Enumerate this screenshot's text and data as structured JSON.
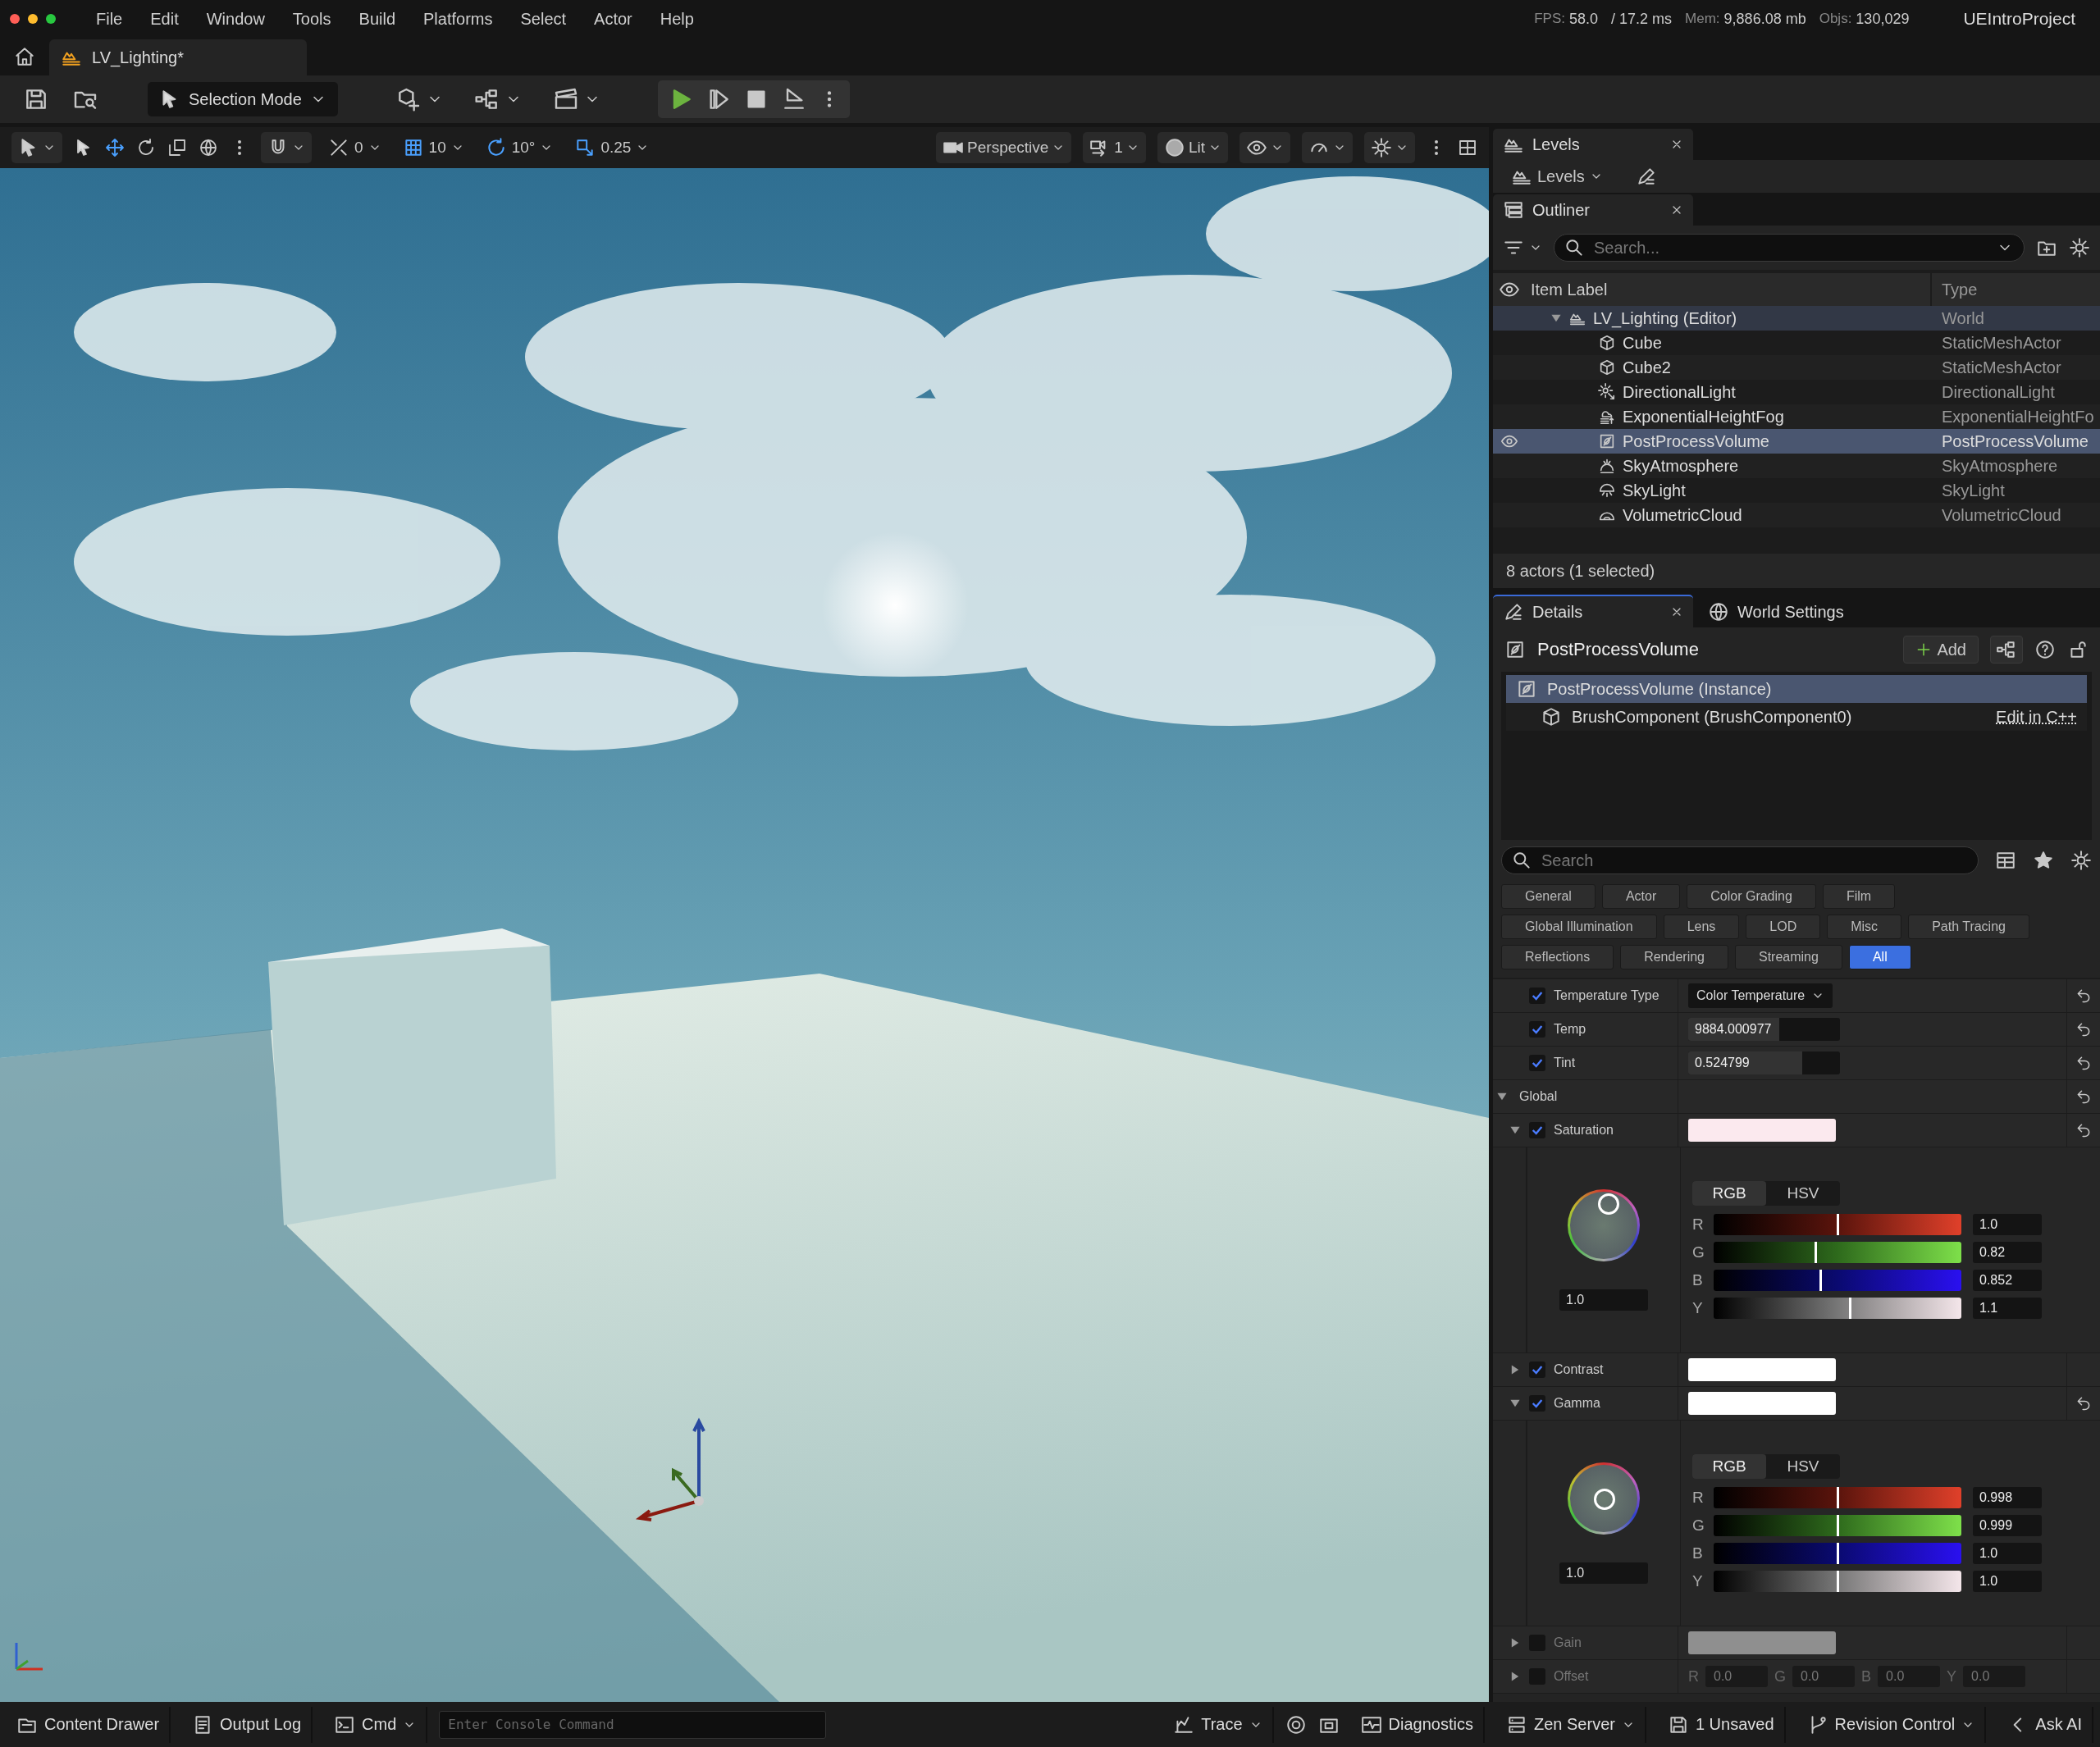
{
  "menu": [
    "File",
    "Edit",
    "Window",
    "Tools",
    "Build",
    "Platforms",
    "Select",
    "Actor",
    "Help"
  ],
  "stats": [
    {
      "label": "FPS:",
      "value": "58.0"
    },
    {
      "value": "/ 17.2 ms"
    },
    {
      "label": "Mem:",
      "value": "9,886.08 mb"
    },
    {
      "label": "Objs:",
      "value": "130,029"
    }
  ],
  "project": "UEIntroProject",
  "document_tab": {
    "label": "LV_Lighting*"
  },
  "toolbar": {
    "mode": "Selection Mode"
  },
  "viewport_toolbar": {
    "snaps": [
      {
        "kind": "surface",
        "value": "0"
      },
      {
        "kind": "grid",
        "value": "10"
      },
      {
        "kind": "rotate",
        "value": "10°"
      },
      {
        "kind": "scale",
        "value": "0.25"
      }
    ],
    "view": "Perspective",
    "camera_speed": "1",
    "view_mode": "Lit"
  },
  "levels": {
    "tab": "Levels",
    "dropdown": "Levels"
  },
  "outliner": {
    "tab": "Outliner",
    "search_placeholder": "Search...",
    "columns": [
      "Item Label",
      "Type"
    ],
    "tree": [
      {
        "label": "LV_Lighting (Editor)",
        "type": "World",
        "kind": "world",
        "expanded": true,
        "selected": false,
        "children": [
          {
            "label": "Cube",
            "type": "StaticMeshActor",
            "kind": "mesh",
            "selected": false
          },
          {
            "label": "Cube2",
            "type": "StaticMeshActor",
            "kind": "mesh",
            "selected": false
          },
          {
            "label": "DirectionalLight",
            "type": "DirectionalLight",
            "kind": "light",
            "selected": false
          },
          {
            "label": "ExponentialHeightFog",
            "type": "ExponentialHeightFo",
            "kind": "fog",
            "selected": false
          },
          {
            "label": "PostProcessVolume",
            "type": "PostProcessVolume",
            "kind": "postprocess",
            "selected": true
          },
          {
            "label": "SkyAtmosphere",
            "type": "SkyAtmosphere",
            "kind": "sky",
            "selected": false
          },
          {
            "label": "SkyLight",
            "type": "SkyLight",
            "kind": "skylight",
            "selected": false
          },
          {
            "label": "VolumetricCloud",
            "type": "VolumetricCloud",
            "kind": "cloud",
            "selected": false
          }
        ]
      }
    ],
    "status": "8 actors (1 selected)"
  },
  "details": {
    "tab": "Details",
    "other_tab": "World Settings",
    "actor": "PostProcessVolume",
    "add": "Add",
    "components": [
      {
        "label": "PostProcessVolume (Instance)",
        "kind": "actor",
        "selected": true
      },
      {
        "label": "BrushComponent (BrushComponent0)",
        "kind": "brush",
        "selected": false,
        "link": "Edit in C++"
      }
    ],
    "search_placeholder": "Search",
    "categories": [
      {
        "label": "General",
        "selected": false
      },
      {
        "label": "Actor",
        "selected": false
      },
      {
        "label": "Color Grading",
        "selected": false
      },
      {
        "label": "Film",
        "selected": false
      },
      {
        "label": "Global Illumination",
        "selected": false
      },
      {
        "label": "Lens",
        "selected": false
      },
      {
        "label": "LOD",
        "selected": false
      },
      {
        "label": "Misc",
        "selected": false
      },
      {
        "label": "Path Tracing",
        "selected": false
      },
      {
        "label": "Reflections",
        "selected": false
      },
      {
        "label": "Rendering",
        "selected": false
      },
      {
        "label": "Streaming",
        "selected": false
      },
      {
        "label": "All",
        "selected": true
      }
    ],
    "properties": [
      {
        "kind": "enum",
        "label": "Temperature Type",
        "checked": true,
        "value": "Color Temperature",
        "resettable": true
      },
      {
        "kind": "number",
        "label": "Temp",
        "checked": true,
        "value": "9884.000977",
        "level": 0.6,
        "resettable": true
      },
      {
        "kind": "number",
        "label": "Tint",
        "checked": true,
        "value": "0.524799",
        "level": 0.75,
        "resettable": true
      },
      {
        "kind": "group",
        "label": "Global",
        "expanded": true,
        "resettable": true
      },
      {
        "kind": "color",
        "label": "Saturation",
        "checked": true,
        "expanded": true,
        "color": "#fbe9ee",
        "resettable": true,
        "picker": {
          "modes": [
            {
              "label": "RGB",
              "selected": true
            },
            {
              "label": "HSV",
              "selected": false
            }
          ],
          "wheel_value": "1.0",
          "channels": [
            {
              "label": "R",
              "value": "1.0",
              "level": 0.5
            },
            {
              "label": "G",
              "value": "0.82",
              "level": 0.41
            },
            {
              "label": "B",
              "value": "0.852",
              "level": 0.43
            },
            {
              "label": "Y",
              "value": "1.1",
              "level": 0.55
            }
          ]
        }
      },
      {
        "kind": "color",
        "label": "Contrast",
        "checked": true,
        "expanded": false,
        "color": "#ffffff",
        "resettable": false
      },
      {
        "kind": "color",
        "label": "Gamma",
        "checked": true,
        "expanded": true,
        "color": "#ffffff",
        "resettable": true,
        "picker": {
          "modes": [
            {
              "label": "RGB",
              "selected": true
            },
            {
              "label": "HSV",
              "selected": false
            }
          ],
          "wheel_value": "1.0",
          "channels": [
            {
              "label": "R",
              "value": "0.998",
              "level": 0.5
            },
            {
              "label": "G",
              "value": "0.999",
              "level": 0.5
            },
            {
              "label": "B",
              "value": "1.0",
              "level": 0.5
            },
            {
              "label": "Y",
              "value": "1.0",
              "level": 0.5
            }
          ]
        }
      },
      {
        "kind": "color",
        "label": "Gain",
        "checked": false,
        "expanded": false,
        "color": "#8f8f8f",
        "resettable": false
      },
      {
        "kind": "vector",
        "label": "Offset",
        "checked": false,
        "expanded": false,
        "resettable": false,
        "fields": [
          {
            "label": "R",
            "value": "0.0"
          },
          {
            "label": "G",
            "value": "0.0"
          },
          {
            "label": "B",
            "value": "0.0"
          },
          {
            "label": "Y",
            "value": "0.0"
          }
        ]
      }
    ]
  },
  "status_bar": {
    "left": [
      {
        "kind": "drawer",
        "label": "Content Drawer"
      },
      {
        "kind": "log",
        "label": "Output Log"
      },
      {
        "kind": "cmd",
        "label": "Cmd"
      }
    ],
    "console_placeholder": "Enter Console Command",
    "right": [
      {
        "kind": "trace",
        "label": "Trace"
      },
      {
        "kind": "diagnostics",
        "label": "Diagnostics"
      },
      {
        "kind": "zen",
        "label": "Zen Server"
      },
      {
        "kind": "unsaved",
        "label": "1 Unsaved"
      },
      {
        "kind": "revision",
        "label": "Revision Control"
      },
      {
        "kind": "ai",
        "label": "Ask AI"
      }
    ]
  }
}
